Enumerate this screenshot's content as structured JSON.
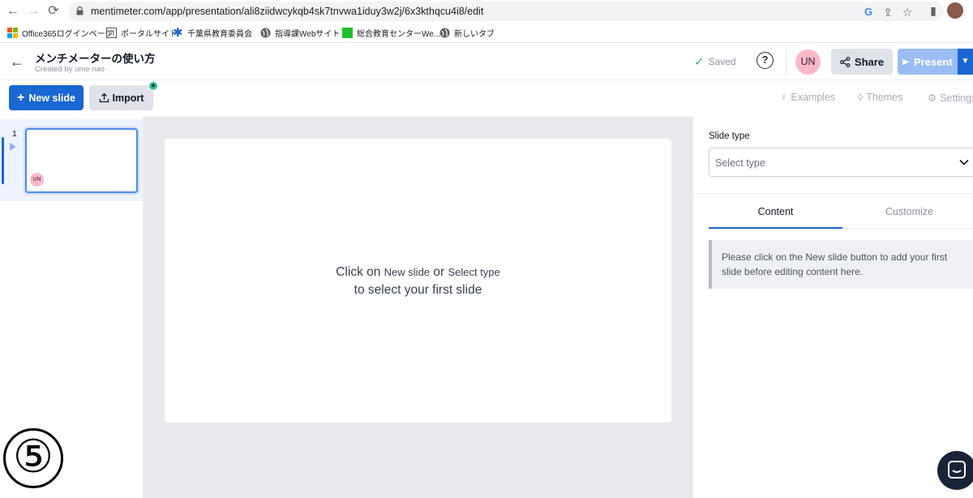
{
  "browser": {
    "url": "mentimeter.com/app/presentation/ali8ziidwcykqb4sk7tnvwa1iduy3w2j/6x3kthqcu4i8/edit",
    "bookmarks": [
      {
        "label": "Office365ログインページ",
        "icon": "microsoft-icon"
      },
      {
        "label": "ポータルサイト",
        "icon": "portal-icon"
      },
      {
        "label": "千葉県教育委員会",
        "icon": "asterisk-icon"
      },
      {
        "label": "指導課Webサイト",
        "icon": "globe-icon"
      },
      {
        "label": "総合教育センターWe...",
        "icon": "green-icon"
      },
      {
        "label": "新しいタブ",
        "icon": "globe-icon"
      }
    ]
  },
  "header": {
    "title": "メンチメーターの使い方",
    "created_by": "Created by ume nao",
    "saved_label": "Saved",
    "help_label": "?",
    "avatar_initials": "UN",
    "share_label": "Share",
    "present_label": "Present"
  },
  "toolbar": {
    "new_slide_label": "New slide",
    "import_label": "Import",
    "examples_label": "Examples",
    "themes_label": "Themes",
    "settings_label": "Settings"
  },
  "slides": {
    "items": [
      {
        "number": "1",
        "avatar": "UN"
      }
    ]
  },
  "canvas": {
    "msg_prefix": "Click on ",
    "msg_new_slide": "New slide",
    "msg_or": " or ",
    "msg_select_type": "Select type",
    "msg_line2": "to select your first slide"
  },
  "panel": {
    "slide_type_label": "Slide type",
    "select_placeholder": "Select type",
    "tab_content": "Content",
    "tab_customize": "Customize",
    "info_text": "Please click on the New slide button to add your first slide before editing content here."
  },
  "overlay": {
    "step_number": "⑤"
  },
  "colors": {
    "primary": "#1967d2",
    "avatar": "#f9b8c8",
    "saved_check": "#2fb67c"
  }
}
